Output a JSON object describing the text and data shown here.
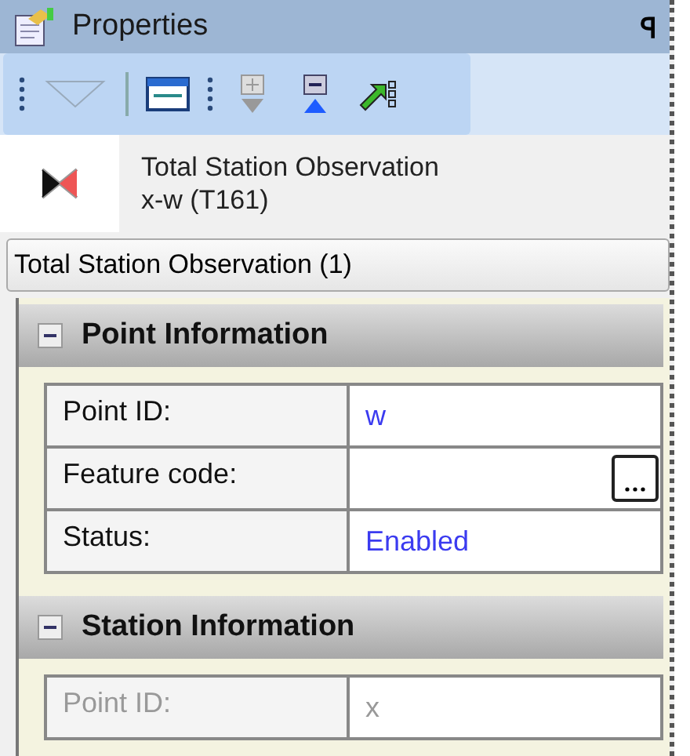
{
  "window": {
    "title": "Properties",
    "pin": "ꟼ"
  },
  "toolbar": {
    "groups": [
      [
        {
          "kind": "dropdown"
        }
      ],
      [
        {
          "kind": "window"
        }
      ]
    ],
    "buttons": [
      {
        "kind": "expand",
        "disabled": true
      },
      {
        "kind": "collapse",
        "disabled": false
      },
      {
        "kind": "goto",
        "disabled": false
      }
    ]
  },
  "header": {
    "title": "Total Station Observation",
    "subtitle": "x-w (T161)"
  },
  "selector": {
    "value": "Total Station Observation (1)"
  },
  "sections": [
    {
      "title": "Point Information",
      "expanded": true,
      "rows": [
        {
          "label": "Point ID:",
          "value": "w",
          "kind": "text",
          "disabled": false
        },
        {
          "label": "Feature code:",
          "kind": "lookup",
          "disabled": false
        },
        {
          "label": "Status:",
          "value": "Enabled",
          "kind": "text",
          "disabled": false
        }
      ]
    },
    {
      "title": "Station Information",
      "expanded": true,
      "rows": [
        {
          "label": "Point ID:",
          "value": "x",
          "kind": "text",
          "disabled": true
        }
      ]
    }
  ]
}
